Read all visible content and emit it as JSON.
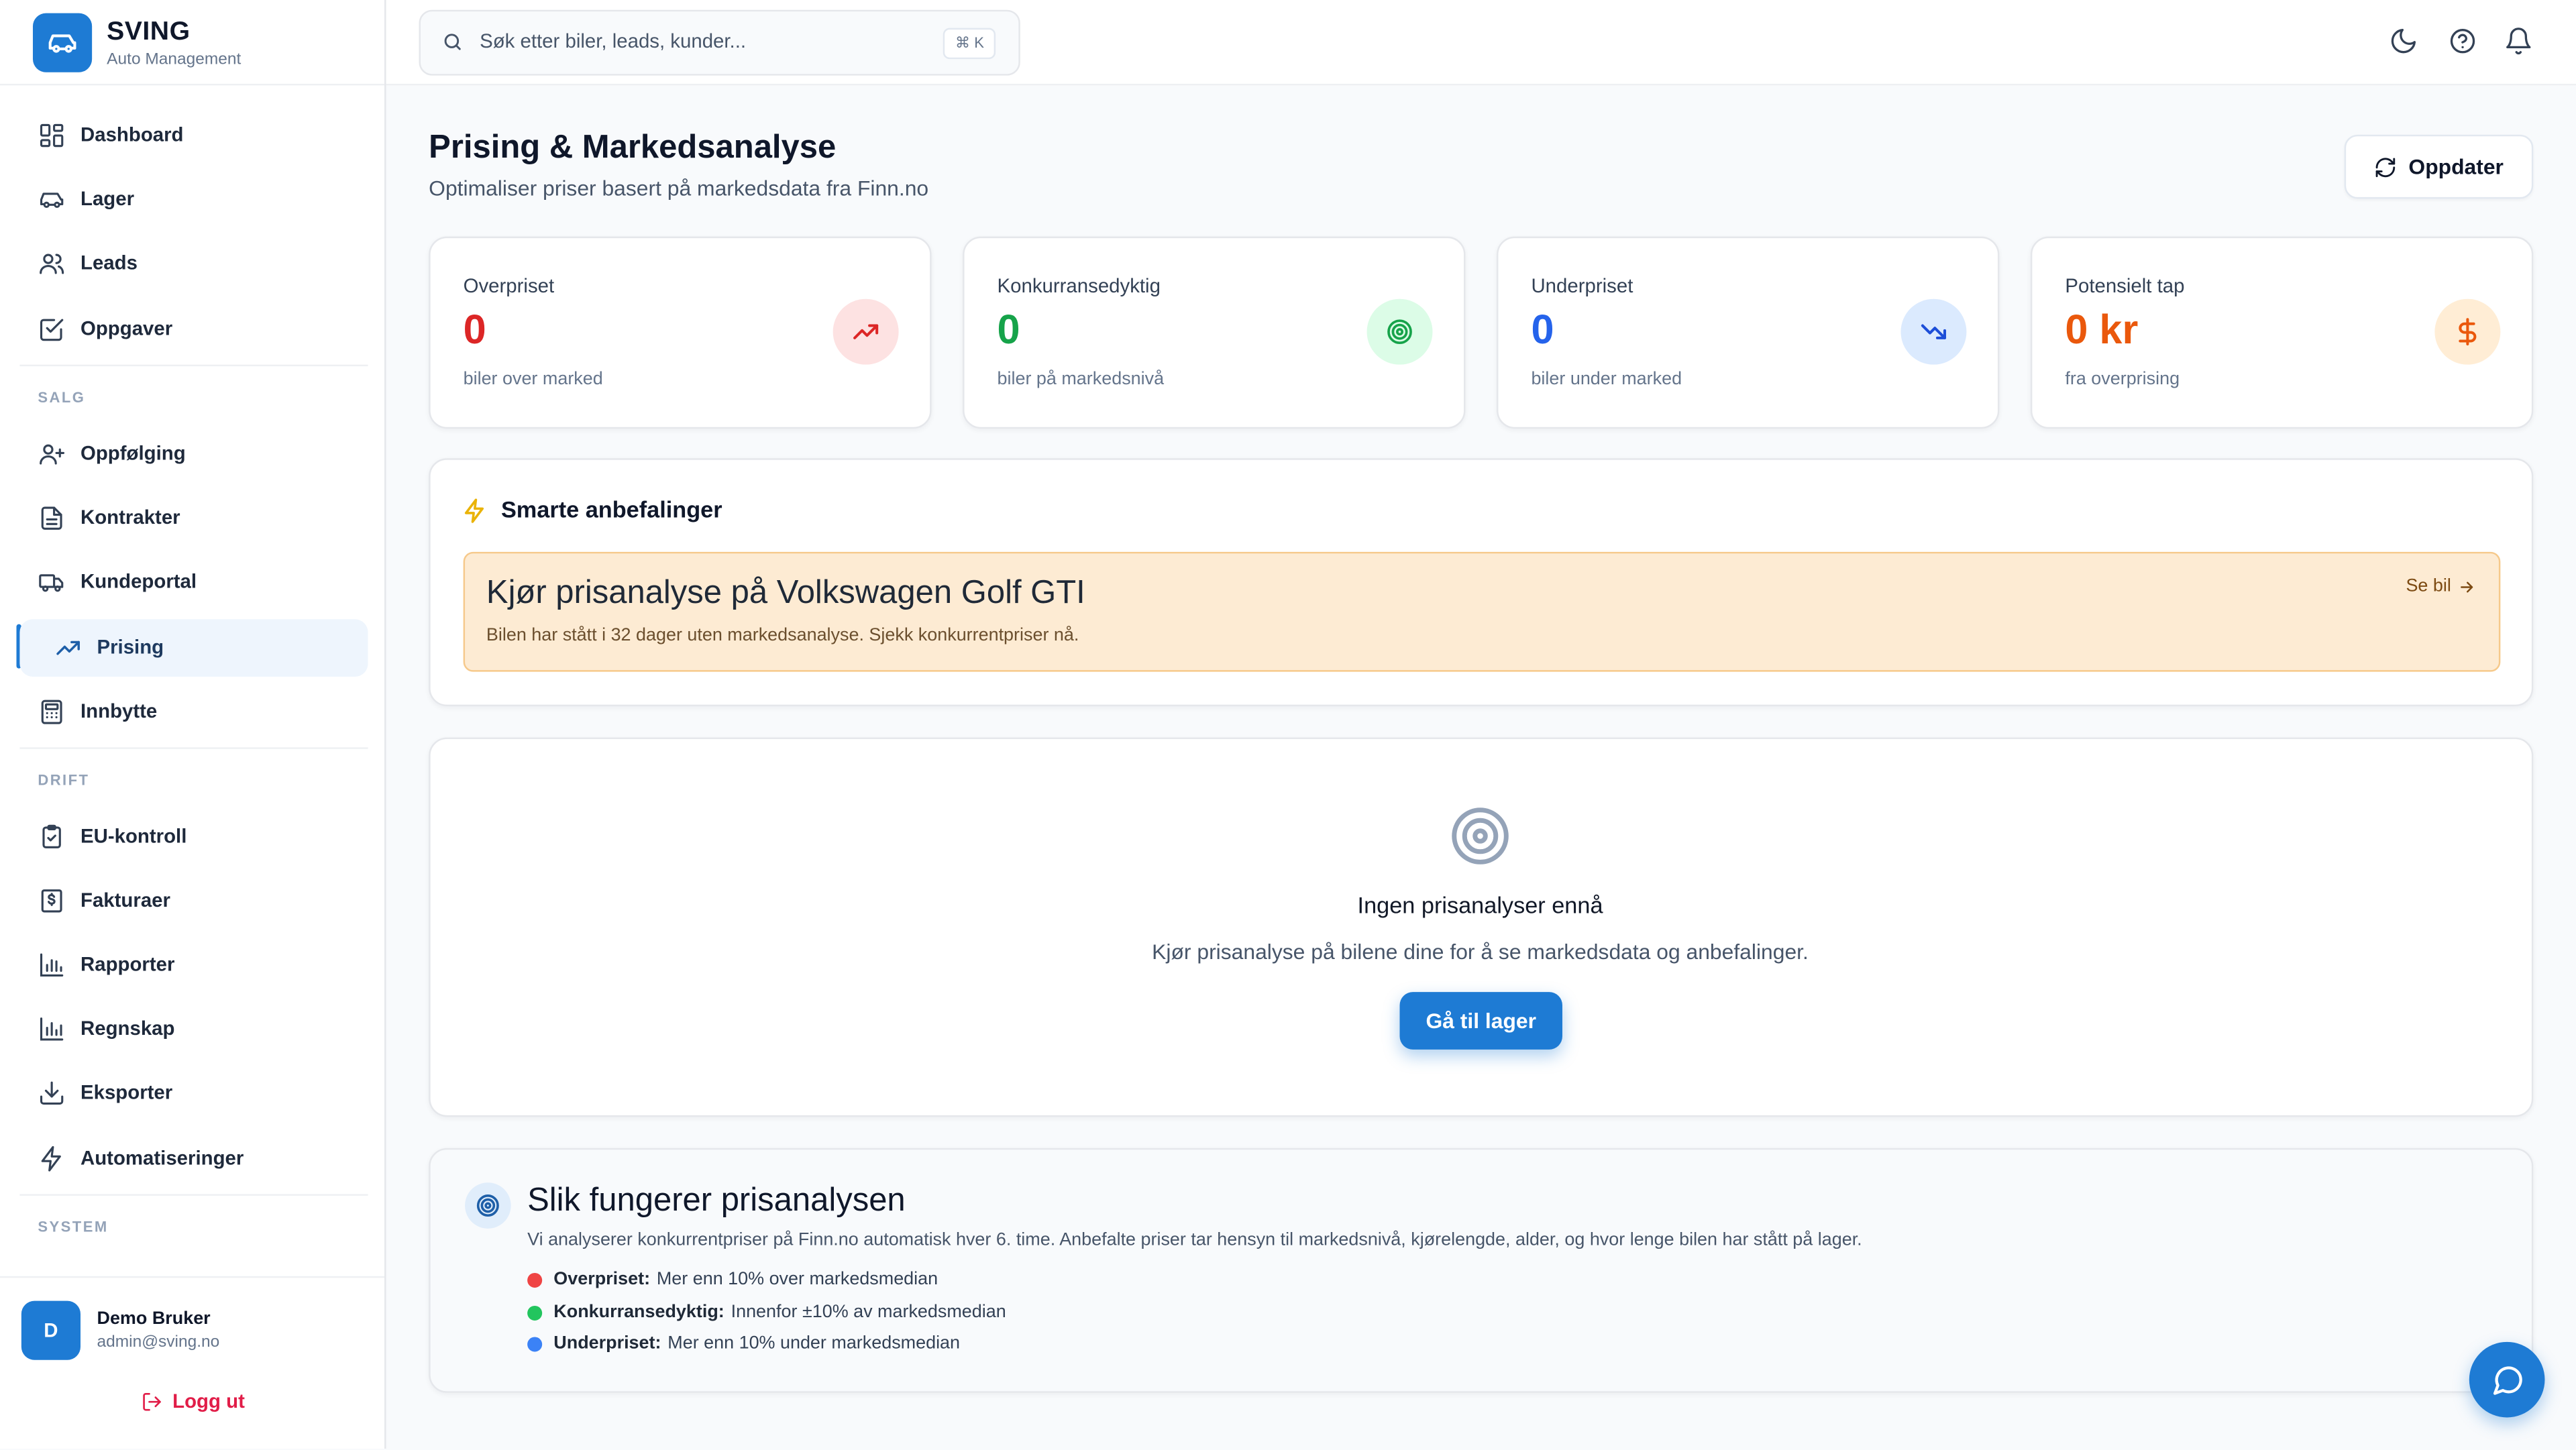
{
  "brand": {
    "name": "SVING",
    "subtitle": "Auto Management"
  },
  "sidebar": {
    "items": [
      {
        "label": "Dashboard",
        "icon": "dashboard-icon"
      },
      {
        "label": "Lager",
        "icon": "car-icon"
      },
      {
        "label": "Leads",
        "icon": "users-icon"
      },
      {
        "label": "Oppgaver",
        "icon": "checkbox-icon"
      }
    ],
    "sections": [
      {
        "label": "SALG",
        "items": [
          {
            "label": "Oppfølging",
            "icon": "user-plus-icon"
          },
          {
            "label": "Kontrakter",
            "icon": "document-icon"
          },
          {
            "label": "Kundeportal",
            "icon": "truck-icon"
          },
          {
            "label": "Prising",
            "icon": "trending-up-icon",
            "active": true
          },
          {
            "label": "Innbytte",
            "icon": "calculator-icon"
          }
        ]
      },
      {
        "label": "DRIFT",
        "items": [
          {
            "label": "EU-kontroll",
            "icon": "clipboard-check-icon"
          },
          {
            "label": "Fakturaer",
            "icon": "invoice-icon"
          },
          {
            "label": "Rapporter",
            "icon": "bar-chart-icon"
          },
          {
            "label": "Regnskap",
            "icon": "bar-chart-icon"
          },
          {
            "label": "Eksporter",
            "icon": "download-icon"
          },
          {
            "label": "Automatiseringer",
            "icon": "lightning-icon"
          }
        ]
      },
      {
        "label": "SYSTEM",
        "items": []
      }
    ],
    "user": {
      "initial": "D",
      "name": "Demo Bruker",
      "email": "admin@sving.no"
    },
    "logout_label": "Logg ut"
  },
  "topbar": {
    "search_placeholder": "Søk etter biler, leads, kunder...",
    "shortcut": "⌘ K",
    "icons": [
      "moon-icon",
      "help-icon",
      "bell-icon"
    ]
  },
  "page": {
    "title": "Prising & Markedsanalyse",
    "subtitle": "Optimaliser priser basert på markedsdata fra Finn.no",
    "refresh_label": "Oppdater"
  },
  "stats": [
    {
      "label": "Overpriset",
      "value": "0",
      "sub": "biler over marked",
      "color": "#dc2626",
      "icon_bg": "#fde2e2",
      "icon": "trending-up-icon"
    },
    {
      "label": "Konkurransedyktig",
      "value": "0",
      "sub": "biler på markedsnivå",
      "color": "#16a34a",
      "icon_bg": "#dcfce7",
      "icon": "target-icon"
    },
    {
      "label": "Underpriset",
      "value": "0",
      "sub": "biler under marked",
      "color": "#2563eb",
      "icon_bg": "#dbeafe",
      "icon": "trending-down-icon"
    },
    {
      "label": "Potensielt tap",
      "value": "0 kr",
      "sub": "fra overprising",
      "color": "#ea580c",
      "icon_bg": "#ffedd5",
      "icon": "dollar-icon"
    }
  ],
  "recommendations": {
    "title": "Smarte anbefalinger",
    "item": {
      "title": "Kjør prisanalyse på Volkswagen Golf GTI",
      "text": "Bilen har stått i 32 dager uten markedsanalyse. Sjekk konkurrentpriser nå.",
      "link": "Se bil"
    }
  },
  "empty_state": {
    "title": "Ingen prisanalyser ennå",
    "text": "Kjør prisanalyse på bilene dine for å se markedsdata og anbefalinger.",
    "button": "Gå til lager"
  },
  "how_it_works": {
    "title": "Slik fungerer prisanalysen",
    "text": "Vi analyserer konkurrentpriser på Finn.no automatisk hver 6. time. Anbefalte priser tar hensyn til markedsnivå, kjørelengde, alder, og hvor lenge bilen har stått på lager.",
    "legend": [
      {
        "label": "Overpriset:",
        "text": "Mer enn 10% over markedsmedian",
        "color": "#ef4444"
      },
      {
        "label": "Konkurransedyktig:",
        "text": "Innenfor ±10% av markedsmedian",
        "color": "#22c55e"
      },
      {
        "label": "Underpriset:",
        "text": "Mer enn 10% under markedsmedian",
        "color": "#3b82f6"
      }
    ]
  },
  "accent_color": "#1e7bd4"
}
